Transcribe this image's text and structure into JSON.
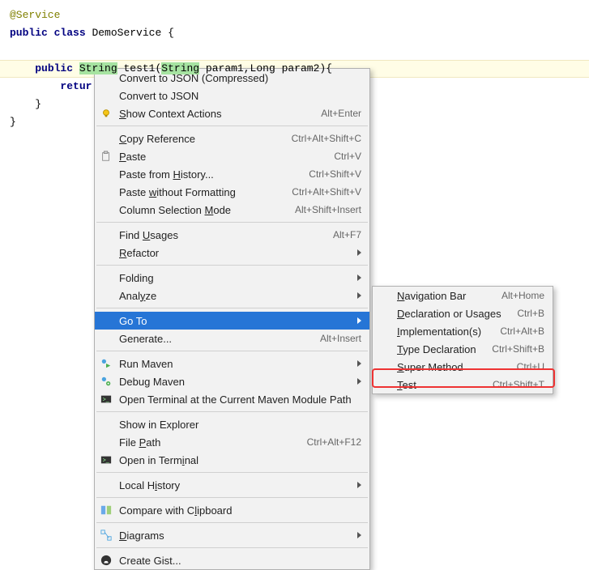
{
  "code": {
    "l1": "@Service",
    "l2_kw1": "public",
    "l2_kw2": "class",
    "l2_name": "DemoService {",
    "l3_kw": "public",
    "l3_type": "String",
    "l3_method": "test1",
    "l3_p1t": "String",
    "l3_p1n": "param1",
    "l3_p2t": "Long",
    "l3_p2n": "param2",
    "l3_end": "){",
    "l4_kw": "retur",
    "l5": "    }",
    "l6": "}"
  },
  "menu": [
    {
      "label": "Convert to JSON (Compressed)"
    },
    {
      "label": "Convert to JSON"
    },
    {
      "label": "Show Context Actions",
      "icon": "bulb",
      "shortcut": "Alt+Enter",
      "underline": 0
    },
    {
      "sep": true
    },
    {
      "label": "Copy Reference",
      "shortcut": "Ctrl+Alt+Shift+C",
      "underline": 0
    },
    {
      "label": "Paste",
      "icon": "paste",
      "shortcut": "Ctrl+V",
      "underline": 0
    },
    {
      "label": "Paste from History...",
      "shortcut": "Ctrl+Shift+V",
      "underline": 11
    },
    {
      "label": "Paste without Formatting",
      "shortcut": "Ctrl+Alt+Shift+V",
      "underline": 6
    },
    {
      "label": "Column Selection Mode",
      "shortcut": "Alt+Shift+Insert",
      "underline": 17
    },
    {
      "sep": true
    },
    {
      "label": "Find Usages",
      "shortcut": "Alt+F7",
      "underline": 5
    },
    {
      "label": "Refactor",
      "submenu": true,
      "underline": 0
    },
    {
      "sep": true
    },
    {
      "label": "Folding",
      "submenu": true
    },
    {
      "label": "Analyze",
      "submenu": true,
      "underline": 4
    },
    {
      "sep": true
    },
    {
      "label": "Go To",
      "submenu": true,
      "hov": true
    },
    {
      "label": "Generate...",
      "shortcut": "Alt+Insert"
    },
    {
      "sep": true
    },
    {
      "label": "Run Maven",
      "icon": "maven-run",
      "submenu": true
    },
    {
      "label": "Debug Maven",
      "icon": "maven-debug",
      "submenu": true
    },
    {
      "label": "Open Terminal at the Current Maven Module Path",
      "icon": "terminal"
    },
    {
      "sep": true
    },
    {
      "label": "Show in Explorer"
    },
    {
      "label": "File Path",
      "shortcut": "Ctrl+Alt+F12",
      "underline": 5
    },
    {
      "label": "Open in Terminal",
      "icon": "terminal2",
      "underline": 12
    },
    {
      "sep": true
    },
    {
      "label": "Local History",
      "submenu": true,
      "underline": 7
    },
    {
      "sep": true
    },
    {
      "label": "Compare with Clipboard",
      "icon": "compare",
      "underline": 14
    },
    {
      "sep": true
    },
    {
      "label": "Diagrams",
      "icon": "diagram",
      "submenu": true,
      "underline": 0
    },
    {
      "sep": true
    },
    {
      "label": "Create Gist...",
      "icon": "github"
    }
  ],
  "submenu": [
    {
      "label": "Navigation Bar",
      "shortcut": "Alt+Home",
      "underline": 0
    },
    {
      "label": "Declaration or Usages",
      "shortcut": "Ctrl+B",
      "underline": 0
    },
    {
      "label": "Implementation(s)",
      "shortcut": "Ctrl+Alt+B",
      "underline": 0
    },
    {
      "label": "Type Declaration",
      "shortcut": "Ctrl+Shift+B",
      "underline": 0
    },
    {
      "label": "Super Method",
      "shortcut": "Ctrl+U",
      "underline": 0
    },
    {
      "label": "Test",
      "shortcut": "Ctrl+Shift+T",
      "underline": 0
    }
  ]
}
